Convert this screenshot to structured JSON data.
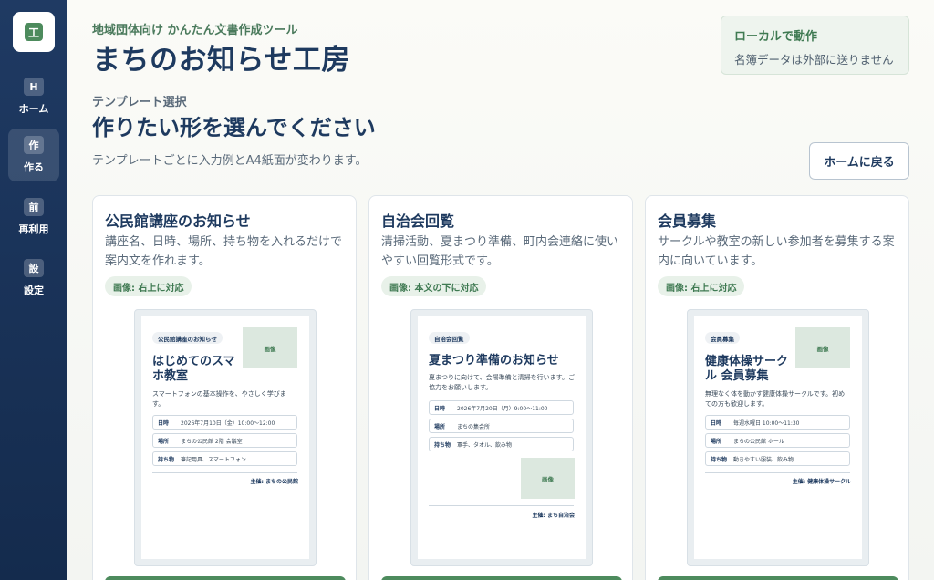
{
  "sidebar": {
    "logo": "工",
    "items": [
      {
        "icon": "H",
        "label": "ホーム"
      },
      {
        "icon": "作",
        "label": "作る"
      },
      {
        "icon": "前",
        "label": "再利用"
      },
      {
        "icon": "設",
        "label": "設定"
      }
    ]
  },
  "header": {
    "eyebrow": "地域団体向け かんたん文書作成ツール",
    "title": "まちのお知らせ工房",
    "local": {
      "title": "ローカルで動作",
      "desc": "名簿データは外部に送りません"
    }
  },
  "section": {
    "label": "テンプレート選択",
    "title": "作りたい形を選んでください",
    "desc": "テンプレートごとに入力例とA4紙面が変わります。",
    "home_button": "ホームに戻る"
  },
  "cards": [
    {
      "title": "公民館講座のお知らせ",
      "desc": "講座名、日時、場所、持ち物を入れるだけで案内文を作れます。",
      "badge": "画像: 右上に対応",
      "preview": {
        "tag": "公民館講座のお知らせ",
        "image": "画像",
        "title": "はじめてのスマホ教室",
        "body": "スマートフォンの基本操作を、やさしく学びます。",
        "rows": [
          {
            "key": "日時",
            "val": "2026年7月10日（金）10:00〜12:00"
          },
          {
            "key": "場所",
            "val": "まちの公民館 2階 会議室"
          },
          {
            "key": "持ち物",
            "val": "筆記用具、スマートフォン"
          }
        ],
        "sign": "主催: まちの公民館"
      }
    },
    {
      "title": "自治会回覧",
      "desc": "清掃活動、夏まつり準備、町内会連絡に使いやすい回覧形式です。",
      "badge": "画像: 本文の下に対応",
      "preview": {
        "tag": "自治会回覧",
        "image": "画像",
        "title": "夏まつり準備のお知らせ",
        "body": "夏まつりに向けて、会場準備と清掃を行います。ご協力をお願いします。",
        "rows": [
          {
            "key": "日時",
            "val": "2026年7月20日（月）9:00〜11:00"
          },
          {
            "key": "場所",
            "val": "まちの集会所"
          },
          {
            "key": "持ち物",
            "val": "軍手、タオル、飲み物"
          }
        ],
        "sign": "主催: まち自治会"
      }
    },
    {
      "title": "会員募集",
      "desc": "サークルや教室の新しい参加者を募集する案内に向いています。",
      "badge": "画像: 右上に対応",
      "preview": {
        "tag": "会員募集",
        "image": "画像",
        "title": "健康体操サークル 会員募集",
        "body": "無理なく体を動かす健康体操サークルです。初めての方も歓迎します。",
        "rows": [
          {
            "key": "日時",
            "val": "毎週水曜日 10:00〜11:30"
          },
          {
            "key": "場所",
            "val": "まちの公民館 ホール"
          },
          {
            "key": "持ち物",
            "val": "動きやすい服装、飲み物"
          }
        ],
        "sign": "主催: 健康体操サークル"
      }
    }
  ]
}
